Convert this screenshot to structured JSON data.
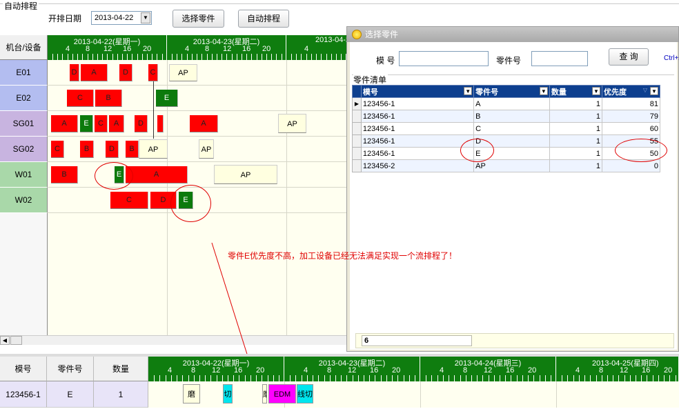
{
  "group_title": "自动排程",
  "toolbar": {
    "date_label": "开排日期",
    "date_value": "2013-04-22",
    "select_parts_button": "选择零件",
    "auto_schedule_button": "自动排程"
  },
  "grid": {
    "corner_label": "机台/设备",
    "days": [
      {
        "date": "2013-04-22(星期一)",
        "hours": [
          "4",
          "8",
          "12",
          "16",
          "20"
        ]
      },
      {
        "date": "2013-04-23(星期二)",
        "hours": [
          "4",
          "8",
          "12",
          "16",
          "20"
        ]
      },
      {
        "date": "2013-04-2",
        "hours": [
          "4"
        ]
      }
    ],
    "machines": [
      {
        "name": "E01",
        "color": "#b3bdf0"
      },
      {
        "name": "E02",
        "color": "#b3bdf0"
      },
      {
        "name": "SG01",
        "color": "#c8b4e0"
      },
      {
        "name": "SG02",
        "color": "#c8b4e0"
      },
      {
        "name": "W01",
        "color": "#a9d8a9"
      },
      {
        "name": "W02",
        "color": "#a9d8a9"
      }
    ],
    "bars": [
      {
        "row": 0,
        "label": "D",
        "kind": "red"
      },
      {
        "row": 0,
        "label": "A",
        "kind": "red"
      },
      {
        "row": 0,
        "label": "D",
        "kind": "red"
      },
      {
        "row": 0,
        "label": "C",
        "kind": "red"
      },
      {
        "row": 0,
        "label": "AP",
        "kind": "ap"
      },
      {
        "row": 1,
        "label": "C",
        "kind": "red"
      },
      {
        "row": 1,
        "label": "B",
        "kind": "red"
      },
      {
        "row": 1,
        "label": "E",
        "kind": "green"
      },
      {
        "row": 2,
        "label": "A",
        "kind": "red"
      },
      {
        "row": 2,
        "label": "E",
        "kind": "green"
      },
      {
        "row": 2,
        "label": "C",
        "kind": "red"
      },
      {
        "row": 2,
        "label": "A",
        "kind": "red"
      },
      {
        "row": 2,
        "label": "D",
        "kind": "red"
      },
      {
        "row": 2,
        "label": "",
        "kind": "red"
      },
      {
        "row": 2,
        "label": "A",
        "kind": "red"
      },
      {
        "row": 2,
        "label": "AP",
        "kind": "ap"
      },
      {
        "row": 3,
        "label": "C",
        "kind": "red"
      },
      {
        "row": 3,
        "label": "B",
        "kind": "red"
      },
      {
        "row": 3,
        "label": "D",
        "kind": "red"
      },
      {
        "row": 3,
        "label": "B",
        "kind": "red"
      },
      {
        "row": 3,
        "label": "AP",
        "kind": "ap"
      },
      {
        "row": 3,
        "label": "AP",
        "kind": "ap"
      },
      {
        "row": 4,
        "label": "B",
        "kind": "red"
      },
      {
        "row": 4,
        "label": "E",
        "kind": "green"
      },
      {
        "row": 4,
        "label": "A",
        "kind": "red"
      },
      {
        "row": 4,
        "label": "AP",
        "kind": "ap"
      },
      {
        "row": 5,
        "label": "C",
        "kind": "red"
      },
      {
        "row": 5,
        "label": "D",
        "kind": "red"
      },
      {
        "row": 5,
        "label": "E",
        "kind": "green"
      }
    ]
  },
  "annotation_text": "零件E优先度不高，加工设备已经无法满足实现一个流排程了！",
  "dialog": {
    "title": "选择零件",
    "mold_label": "模 号",
    "part_label": "零件号",
    "query_button": "查 询",
    "shortcut_hint": "Ctrl+A",
    "list_title": "零件清单",
    "columns": [
      "模号",
      "零件号",
      "数量",
      "优先度"
    ],
    "rows": [
      [
        "123456-1",
        "A",
        "1",
        "81"
      ],
      [
        "123456-1",
        "B",
        "1",
        "79"
      ],
      [
        "123456-1",
        "C",
        "1",
        "60"
      ],
      [
        "123456-1",
        "D",
        "1",
        "55"
      ],
      [
        "123456-1",
        "E",
        "1",
        "50"
      ],
      [
        "123456-2",
        "AP",
        "1",
        "0"
      ]
    ],
    "row_count": "6"
  },
  "bottom": {
    "headers": [
      "模号",
      "零件号",
      "数量"
    ],
    "row": [
      "123456-1",
      "E",
      "1"
    ],
    "days": [
      {
        "date": "2013-04-22(星期一)",
        "hours": [
          "4",
          "8",
          "12",
          "16",
          "20"
        ]
      },
      {
        "date": "2013-04-23(星期二)",
        "hours": [
          "4",
          "8",
          "12",
          "16",
          "20"
        ]
      },
      {
        "date": "2013-04-24(星期三)",
        "hours": [
          "4",
          "8",
          "12",
          "16",
          "20"
        ]
      },
      {
        "date": "2013-04-25(星期四)",
        "hours": [
          "4",
          "8",
          "12",
          "16",
          "20"
        ]
      }
    ],
    "ops": [
      {
        "label": "磨",
        "color": "#ffffe0"
      },
      {
        "label": "切",
        "color": "#00e5ee"
      },
      {
        "label": "磨",
        "color": "#ffffe0"
      },
      {
        "label": "EDM",
        "color": "#ff00ff"
      },
      {
        "label": "线切割",
        "color": "#00e5ee"
      }
    ]
  }
}
